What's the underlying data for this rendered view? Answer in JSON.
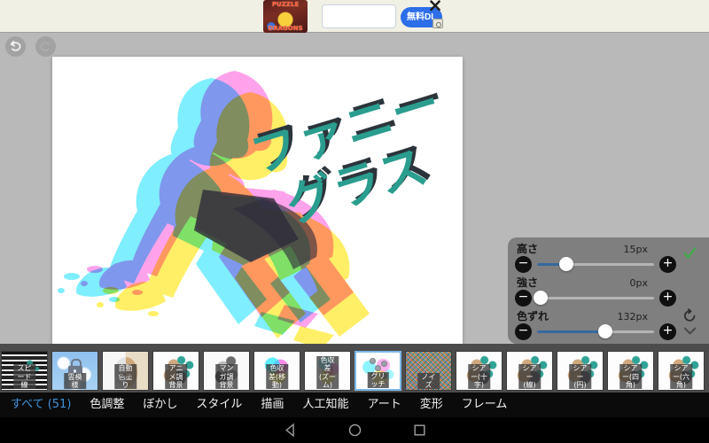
{
  "ad": {
    "game_title_line1": "PUZZLE",
    "game_title_line2": "DRAGONS",
    "search_value": "",
    "download_label": "無料DL",
    "close_label": "×"
  },
  "toolbar": {
    "undo": "undo",
    "redo": "redo"
  },
  "artwork": {
    "title_line1": "ファニー",
    "title_line2": "グラス",
    "teal": "#2a9d8f",
    "shadow": "#2c343b",
    "cyan": "#00ddff",
    "magenta": "#ff2fd4",
    "yellow": "#ffe400",
    "dark": "#2e2b38"
  },
  "params_panel": {
    "minus_label": "−",
    "plus_label": "+",
    "confirm_color": "#3fae49",
    "sliders": [
      {
        "label": "高さ",
        "value": "15px",
        "percent": 25
      },
      {
        "label": "強さ",
        "value": "0px",
        "percent": 3
      },
      {
        "label": "色ずれ",
        "value": "132px",
        "percent": 58
      }
    ]
  },
  "filters": {
    "selected_label": "グリッチ",
    "selected_border": "#7cb9ea",
    "items": [
      {
        "label": "スピード線",
        "type": "speedline",
        "locked": false,
        "selected": false
      },
      {
        "label": "雲模様",
        "type": "cloud",
        "locked": true,
        "selected": false
      },
      {
        "label": "自動色塗り",
        "type": "face",
        "locked": false,
        "selected": false
      },
      {
        "label": "アニメ調背景",
        "type": "anime",
        "locked": false,
        "selected": false
      },
      {
        "label": "マンガ調背景",
        "type": "manga",
        "locked": false,
        "selected": false
      },
      {
        "label": "色収差(移動)",
        "type": "aberr",
        "locked": false,
        "selected": false
      },
      {
        "label": "色収差\n(ズーム)",
        "type": "aberr2",
        "locked": false,
        "selected": false
      },
      {
        "label": "グリッチ",
        "type": "glitch",
        "locked": false,
        "selected": true
      },
      {
        "label": "ノイズ",
        "type": "noise",
        "locked": false,
        "selected": false
      },
      {
        "label": "シアー(十字)",
        "type": "shear",
        "locked": false,
        "selected": false
      },
      {
        "label": "シアー(線)",
        "type": "shear",
        "locked": false,
        "selected": false
      },
      {
        "label": "シアー(円)",
        "type": "shear",
        "locked": false,
        "selected": false
      },
      {
        "label": "シアー(四角)",
        "type": "shear",
        "locked": false,
        "selected": false
      },
      {
        "label": "シアー(六角)",
        "type": "shear",
        "locked": false,
        "selected": false
      }
    ]
  },
  "categories": {
    "active_color": "#3e92d8",
    "items": [
      {
        "label": "すべて (51)",
        "active": true
      },
      {
        "label": "色調整",
        "active": false
      },
      {
        "label": "ぼかし",
        "active": false
      },
      {
        "label": "スタイル",
        "active": false
      },
      {
        "label": "描画",
        "active": false
      },
      {
        "label": "人工知能",
        "active": false
      },
      {
        "label": "アート",
        "active": false
      },
      {
        "label": "変形",
        "active": false
      },
      {
        "label": "フレーム",
        "active": false
      }
    ]
  },
  "android_nav": {
    "back": "back",
    "home": "home",
    "recents": "recents"
  }
}
